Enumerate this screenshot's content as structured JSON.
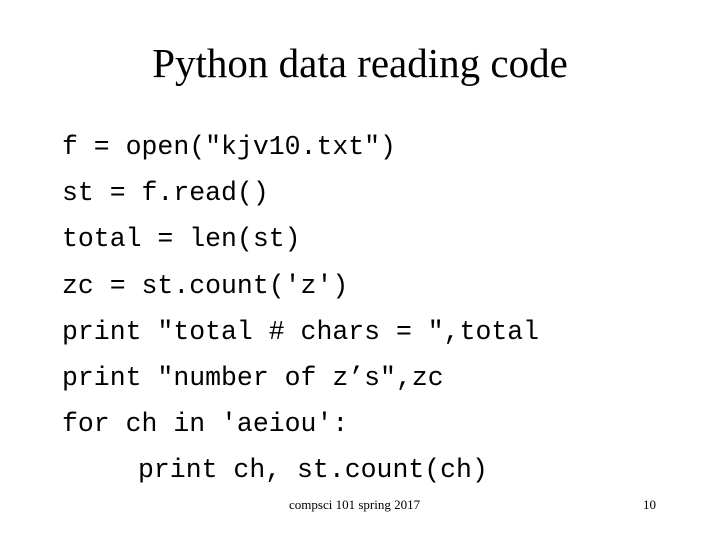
{
  "slide": {
    "title": "Python data reading code",
    "code_lines": [
      {
        "text": "f = open(\"kjv10.txt\")",
        "indent": 0
      },
      {
        "text": "st = f.read()",
        "indent": 0
      },
      {
        "text": "total = len(st)",
        "indent": 0
      },
      {
        "text": "zc = st.count('z')",
        "indent": 0
      },
      {
        "text": "print \"total # chars = \",total",
        "indent": 0
      },
      {
        "text": "print \"number of z’s\",zc",
        "indent": 0
      },
      {
        "text": "for ch in 'aeiou':",
        "indent": 0
      },
      {
        "text": "print ch, st.count(ch)",
        "indent": 1
      }
    ],
    "footer": {
      "course": "compsci 101 spring 2017",
      "page_number": "10"
    }
  }
}
